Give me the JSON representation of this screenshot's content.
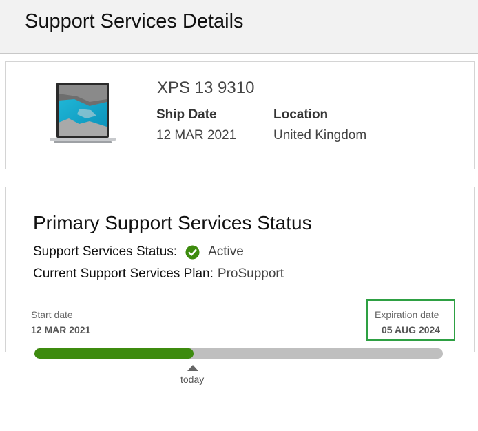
{
  "header": {
    "title": "Support Services Details"
  },
  "product": {
    "name": "XPS 13 9310",
    "image_icon": "laptop-image",
    "ship_date_label": "Ship Date",
    "ship_date_value": "12 MAR 2021",
    "location_label": "Location",
    "location_value": "United Kingdom"
  },
  "status": {
    "title": "Primary Support Services Status",
    "status_label": "Support Services Status:",
    "status_value": "Active",
    "status_icon": "check-circle-icon",
    "plan_label": "Current Support Services Plan:",
    "plan_value": "ProSupport",
    "start_label": "Start date",
    "start_value": "12 MAR 2021",
    "expiration_label": "Expiration date",
    "expiration_value": "05 AUG 2024",
    "progress_fraction": 0.39,
    "today_label": "today"
  },
  "colors": {
    "accent_green": "#3d8b0e",
    "highlight_box": "#2ea043",
    "track_gray": "#bfbfbf"
  }
}
